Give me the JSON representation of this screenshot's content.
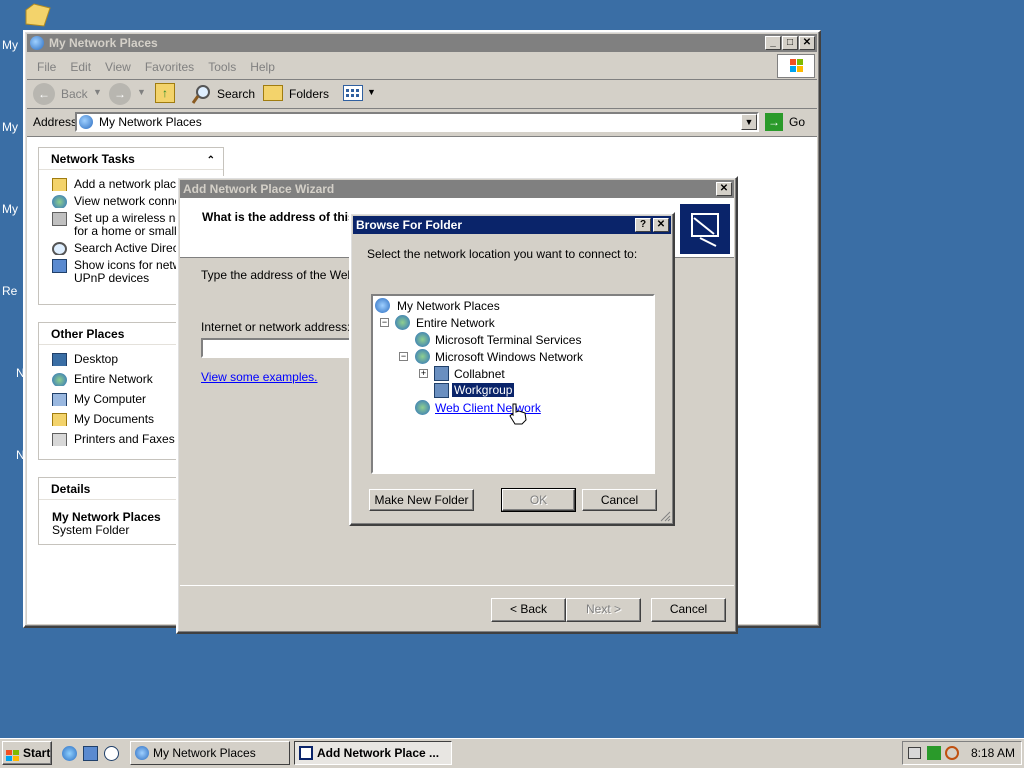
{
  "desktop": {
    "labels": [
      "My",
      "My",
      "My",
      "Re",
      "N",
      "N"
    ]
  },
  "explorer": {
    "title": "My Network Places",
    "menu": [
      "File",
      "Edit",
      "View",
      "Favorites",
      "Tools",
      "Help"
    ],
    "toolbar": {
      "back": "Back",
      "search": "Search",
      "folders": "Folders"
    },
    "address_label": "Address",
    "address_value": "My Network Places",
    "go": "Go",
    "network_tasks": {
      "title": "Network Tasks",
      "items": [
        "Add a network place",
        "View network connections",
        "Set up a wireless network",
        "for a home or small office",
        "Search Active Directory",
        "Show icons for networked",
        "UPnP devices"
      ]
    },
    "other_places": {
      "title": "Other Places",
      "items": [
        "Desktop",
        "Entire Network",
        "My Computer",
        "My Documents",
        "Printers and Faxes"
      ]
    },
    "details": {
      "title": "Details",
      "name": "My Network Places",
      "type": "System Folder"
    }
  },
  "wizard": {
    "title": "Add Network Place Wizard",
    "question": "What is the address of this network place?",
    "instructions": "Type the address of the Web site",
    "field_label": "Internet or network address:",
    "examples_link": "View some examples.",
    "buttons": {
      "back": "< Back",
      "next": "Next >",
      "cancel": "Cancel"
    }
  },
  "browse": {
    "title": "Browse For Folder",
    "prompt": "Select the network location you want to connect to:",
    "tree": [
      {
        "label": "My Network Places"
      },
      {
        "label": "Entire Network"
      },
      {
        "label": "Microsoft Terminal Services"
      },
      {
        "label": "Microsoft Windows Network"
      },
      {
        "label": "Collabnet"
      },
      {
        "label": "Workgroup"
      },
      {
        "label": "Web Client Network"
      }
    ],
    "buttons": {
      "new_folder": "Make New Folder",
      "ok": "OK",
      "cancel": "Cancel"
    }
  },
  "taskbar": {
    "start": "Start",
    "tasks": [
      "My Network Places",
      "Add Network Place ..."
    ],
    "clock": "8:18 AM"
  }
}
